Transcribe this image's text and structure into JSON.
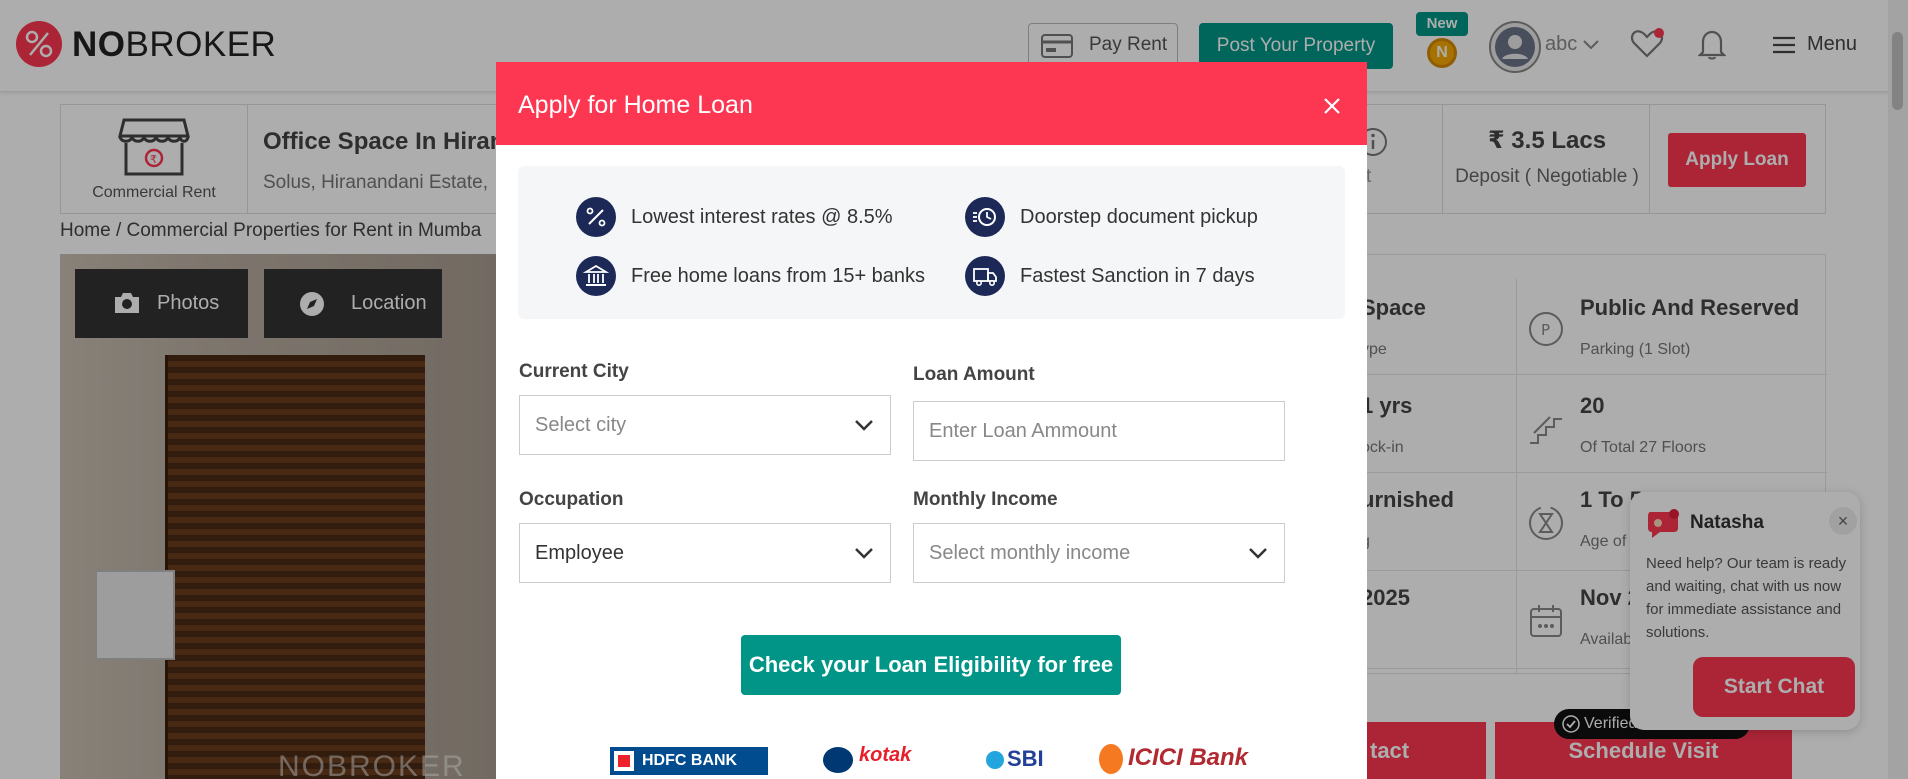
{
  "header": {
    "logo_no": "NO",
    "logo_broker": "BROKER",
    "pay_rent": "Pay Rent",
    "post_property": "Post Your Property",
    "new_badge": "New",
    "coin_letter": "N",
    "user_name": "abc",
    "menu": "Menu"
  },
  "property": {
    "rent_type": "Commercial Rent",
    "title": "Office Space In Hiran",
    "address": "Solus, Hiranandani Estate,",
    "deposit_value": "₹ 3.5 Lacs",
    "deposit_label": "Deposit ( Negotiable )",
    "apply_loan": "Apply Loan",
    "info_fragment": "t"
  },
  "breadcrumb": "Home / Commercial Properties for Rent in Mumba",
  "photo": {
    "photos_btn": "Photos",
    "location_btn": "Location",
    "watermark": "NOBROKER"
  },
  "details": [
    {
      "title": "Space",
      "sub": "ype",
      "title2": "Public And Reserved",
      "sub2": "Parking  (1 Slot)"
    },
    {
      "title": "1 yrs",
      "sub": "ock-in",
      "title2": "20",
      "sub2": "Of Total 27 Floors"
    },
    {
      "title": "urnished",
      "sub": "g",
      "title2": "1 To 5",
      "sub2": "Age of B"
    },
    {
      "title": "2025",
      "sub": "",
      "title2": "Nov 2",
      "sub2": "Availab"
    }
  ],
  "actions": {
    "contact": "tact",
    "schedule": "Schedule Visit",
    "verified": "Verified"
  },
  "chat": {
    "name": "Natasha",
    "message": "Need help? Our team is ready and waiting, chat with us now for immediate assistance and solutions.",
    "start": "Start Chat"
  },
  "modal": {
    "title": "Apply for Home Loan",
    "features": [
      "Lowest interest rates @ 8.5%",
      "Doorstep document pickup",
      "Free home loans from 15+ banks",
      "Fastest Sanction in 7 days"
    ],
    "current_city_label": "Current City",
    "current_city_placeholder": "Select city",
    "loan_amount_label": "Loan Amount",
    "loan_amount_placeholder": "Enter Loan Ammount",
    "occupation_label": "Occupation",
    "occupation_value": "Employee",
    "monthly_income_label": "Monthly Income",
    "monthly_income_placeholder": "Select monthly income",
    "check_button": "Check your Loan Eligibility for free",
    "banks": [
      "HDFC BANK",
      "kotak",
      "SBI",
      "ICICI Bank"
    ]
  },
  "colors": {
    "brand_red": "#fd3752",
    "teal": "#009587",
    "navy": "#1c2957"
  }
}
